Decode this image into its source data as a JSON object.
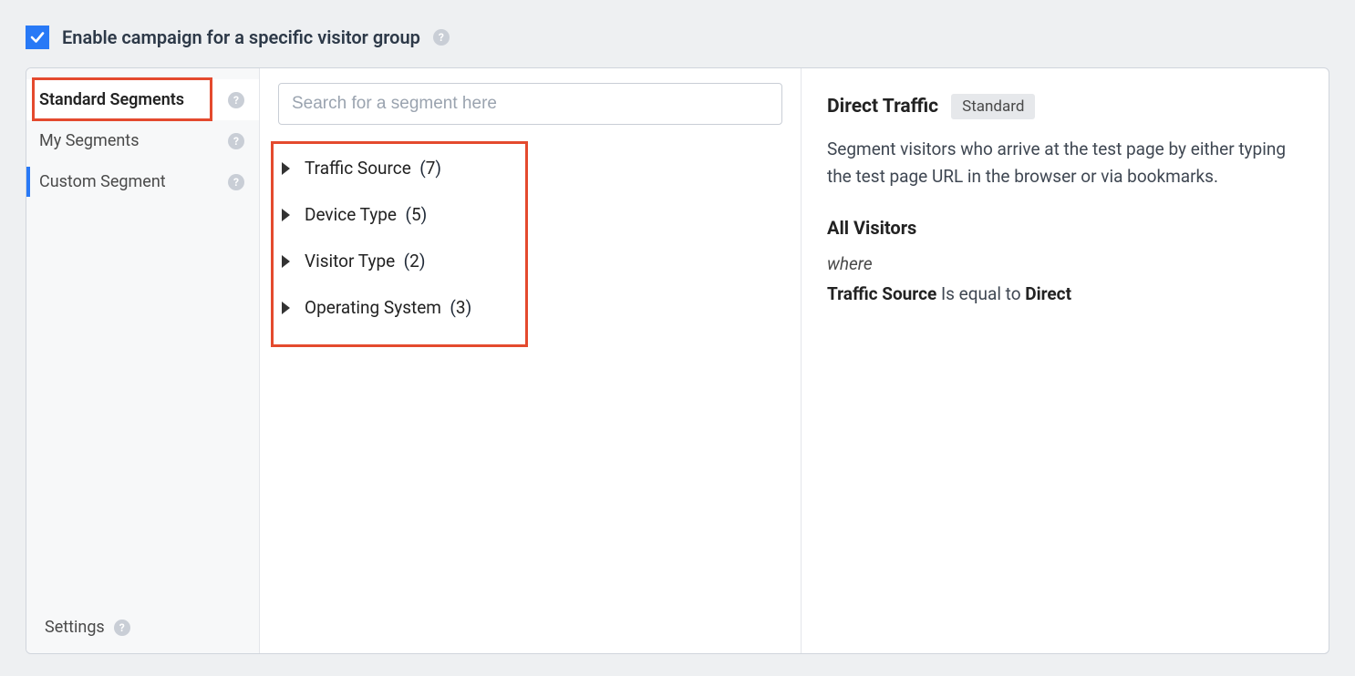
{
  "header": {
    "checked": true,
    "label": "Enable campaign for a specific visitor group"
  },
  "sidebar": {
    "items": [
      {
        "label": "Standard Segments",
        "active": true
      },
      {
        "label": "My Segments",
        "active": false
      },
      {
        "label": "Custom Segment",
        "active": false
      }
    ],
    "footer": "Settings"
  },
  "search": {
    "placeholder": "Search for a segment here"
  },
  "categories": [
    {
      "label": "Traffic Source",
      "count": 7
    },
    {
      "label": "Device Type",
      "count": 5
    },
    {
      "label": "Visitor Type",
      "count": 2
    },
    {
      "label": "Operating System",
      "count": 3
    }
  ],
  "detail": {
    "title": "Direct Traffic",
    "badge": "Standard",
    "description": "Segment visitors who arrive at the test page by either typing the test page URL in the browser or via bookmarks.",
    "subhead": "All Visitors",
    "where": "where",
    "cond_field": "Traffic Source",
    "cond_op": "Is equal to",
    "cond_value": "Direct"
  }
}
